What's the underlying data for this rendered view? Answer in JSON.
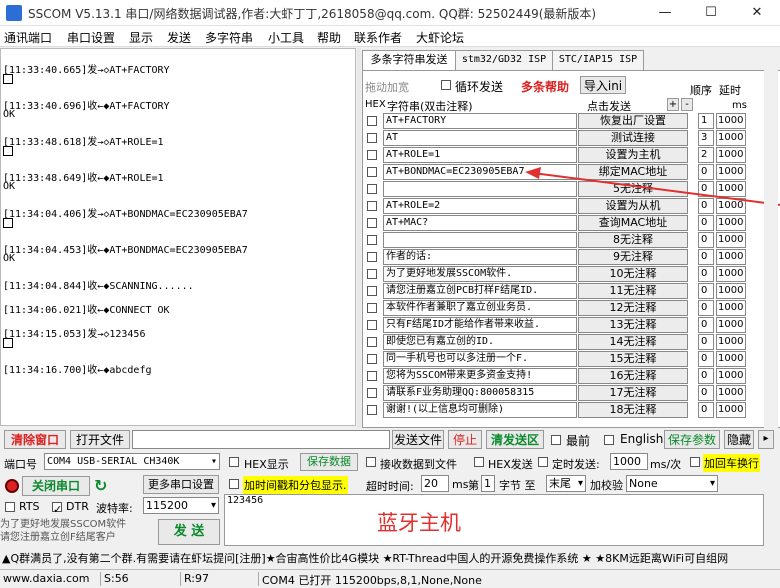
{
  "window": {
    "title": "SSCOM V5.13.1 串口/网络数据调试器,作者:大虾丁丁,2618058@qq.com. QQ群: 52502449(最新版本)"
  },
  "menu": [
    "通讯端口",
    "串口设置",
    "显示",
    "发送",
    "多字符串",
    "小工具",
    "帮助",
    "联系作者",
    "大虾论坛"
  ],
  "log": [
    {
      "time": "[11:33:40.665]",
      "dir": "发→◇",
      "text": "AT+FACTORY",
      "box": true,
      "ok": false
    },
    {
      "time": "[11:33:40.696]",
      "dir": "收←◆",
      "text": "AT+FACTORY",
      "box": false,
      "ok": true
    },
    {
      "time": "[11:33:48.618]",
      "dir": "发→◇",
      "text": "AT+ROLE=1",
      "box": true,
      "ok": false
    },
    {
      "time": "[11:33:48.649]",
      "dir": "收←◆",
      "text": "AT+ROLE=1",
      "box": false,
      "ok": true
    },
    {
      "time": "[11:34:04.406]",
      "dir": "发→◇",
      "text": "AT+BONDMAC=EC230905EBA7",
      "box": true,
      "ok": false
    },
    {
      "time": "[11:34:04.453]",
      "dir": "收←◆",
      "text": "AT+BONDMAC=EC230905EBA7",
      "box": false,
      "ok": true
    },
    {
      "time": "[11:34:04.844]",
      "dir": "收←◆",
      "text": "SCANNING......",
      "box": false,
      "ok": false
    },
    {
      "time": "[11:34:06.021]",
      "dir": "收←◆",
      "text": "CONNECT OK",
      "box": false,
      "ok": false
    },
    {
      "time": "[11:34:15.053]",
      "dir": "发→◇",
      "text": "123456",
      "box": true,
      "ok": false
    },
    {
      "time": "[11:34:16.700]",
      "dir": "收←◆",
      "text": "abcdefg",
      "box": false,
      "ok": false
    }
  ],
  "log_ok": "OK",
  "tabs": [
    "多条字符串发送",
    "stm32/GD32 ISP",
    "STC/IAP15 ISP"
  ],
  "panel": {
    "drag_label": "拖动加宽",
    "loop_label": "循环发送",
    "help_label": "多条帮助",
    "import_label": "导入ini",
    "order_label": "顺序",
    "delay_label": "延时",
    "hex_header": "HEX",
    "str_header": "字符串(双击注释)",
    "send_header": "点击发送",
    "ms_label": "ms",
    "plus": "+",
    "minus": "-"
  },
  "rows": [
    {
      "cmd": "AT+FACTORY",
      "btn": "恢复出厂设置",
      "ord": "1",
      "dly": "1000"
    },
    {
      "cmd": "AT",
      "btn": "测试连接",
      "ord": "3",
      "dly": "1000"
    },
    {
      "cmd": "AT+ROLE=1",
      "btn": "设置为主机",
      "ord": "2",
      "dly": "1000"
    },
    {
      "cmd": "AT+BONDMAC=EC230905EBA7",
      "btn": "绑定MAC地址",
      "ord": "0",
      "dly": "1000"
    },
    {
      "cmd": "",
      "btn": "5无注释",
      "ord": "0",
      "dly": "1000"
    },
    {
      "cmd": "AT+ROLE=2",
      "btn": "设置为从机",
      "ord": "0",
      "dly": "1000"
    },
    {
      "cmd": "AT+MAC?",
      "btn": "查询MAC地址",
      "ord": "0",
      "dly": "1000"
    },
    {
      "cmd": "",
      "btn": "8无注释",
      "ord": "0",
      "dly": "1000"
    },
    {
      "cmd": "作者的话:",
      "btn": "9无注释",
      "ord": "0",
      "dly": "1000"
    },
    {
      "cmd": "为了更好地发展SSCOM软件.",
      "btn": "10无注释",
      "ord": "0",
      "dly": "1000"
    },
    {
      "cmd": "请您注册嘉立创PCB打样F结尾ID.",
      "btn": "11无注释",
      "ord": "0",
      "dly": "1000"
    },
    {
      "cmd": "本软件作者兼职了嘉立创业务员.",
      "btn": "12无注释",
      "ord": "0",
      "dly": "1000"
    },
    {
      "cmd": "只有F结尾ID才能给作者带来收益.",
      "btn": "13无注释",
      "ord": "0",
      "dly": "1000"
    },
    {
      "cmd": "即使您已有嘉立创的ID.",
      "btn": "14无注释",
      "ord": "0",
      "dly": "1000"
    },
    {
      "cmd": "同一手机号也可以多注册一个F.",
      "btn": "15无注释",
      "ord": "0",
      "dly": "1000"
    },
    {
      "cmd": "您将为SSCOM带来更多资金支持!",
      "btn": "16无注释",
      "ord": "0",
      "dly": "1000"
    },
    {
      "cmd": "请联系F业务助理QQ:800058315",
      "btn": "17无注释",
      "ord": "0",
      "dly": "1000"
    },
    {
      "cmd": "谢谢!(以上信息均可删除)",
      "btn": "18无注释",
      "ord": "0",
      "dly": "1000"
    }
  ],
  "toolbar": {
    "clear_window": "清除窗口",
    "open_file": "打开文件",
    "send_file": "发送文件",
    "stop": "停止",
    "clear_send": "清发送区",
    "topmost": "最前",
    "english": "English",
    "save_params": "保存参数",
    "hide": "隐藏"
  },
  "port": {
    "port_label": "端口号",
    "port_value": "COM4 USB-SERIAL CH340K",
    "hex_display": "HEX显示",
    "save_data": "保存数据",
    "recv_to_file": "接收数据到文件",
    "hex_send": "HEX发送",
    "timed_send": "定时发送:",
    "timed_value": "1000",
    "ms_per": "ms/次",
    "crlf": "加回车换行",
    "close_port": "关闭串口",
    "more_settings": "更多串口设置",
    "timestamp": "加时间戳和分包显示.",
    "timeout_label": "超时时间:",
    "timeout_value": "20",
    "ms": "ms",
    "nth_label": "第",
    "nth_value": "1",
    "byte_to": "字节 至",
    "end_value": "末尾",
    "checksum_label": "加校验",
    "checksum_value": "None",
    "rts": "RTS",
    "dtr": "DTR",
    "baud_label": "波特率:",
    "baud_value": "115200",
    "send": "发 送",
    "promo": "为了更好地发展SSCOM软件\n请您注册嘉立创F结尾客户"
  },
  "send_area": {
    "text": "123456",
    "annotation": "蓝牙主机"
  },
  "ticker": "▲Q群满员了,没有第二个群.有需要请在虾坛提问[注册]★合宙高性价比4G模块 ★RT-Thread中国人的开源免费操作系统 ★ ★8KM远距离WiFi可自组网",
  "status": {
    "url": "www.daxia.com",
    "s": "S:56",
    "r": "R:97",
    "port": "COM4 已打开  115200bps,8,1,None,None"
  },
  "colors": {
    "red_label": "#d22222",
    "green_label": "#0a8a2c",
    "highlight": "#ffff00",
    "annotation": "#e03030"
  }
}
